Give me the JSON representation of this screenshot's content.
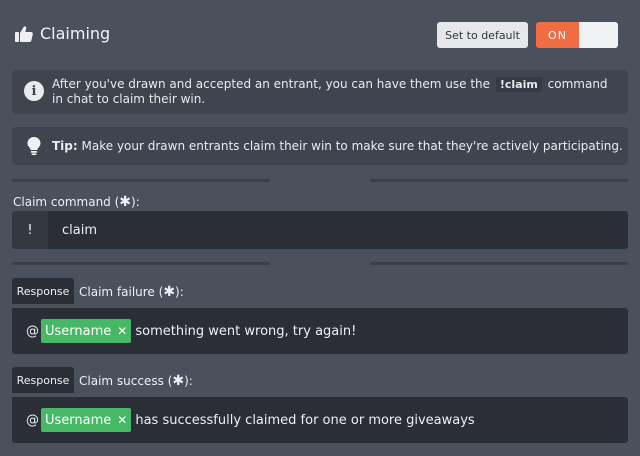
{
  "header": {
    "title": "Claiming",
    "title_icon": "thumbs-up-icon",
    "set_default_label": "Set to default",
    "toggle_label": "ON"
  },
  "info": {
    "icon": "info-icon",
    "text_before": "After you've drawn and accepted an entrant, you can have them use the",
    "command": "!claim",
    "text_after": "command in chat to claim their win."
  },
  "tip": {
    "icon": "lightbulb-icon",
    "prefix": "Tip:",
    "text": "Make your drawn entrants claim their win to make sure that they're actively participating."
  },
  "claim_command": {
    "label": "Claim command (",
    "required_mark": "✱",
    "label_end": "):",
    "prefix": "!",
    "value": "claim"
  },
  "claim_failure": {
    "tag": "Response",
    "label": "Claim failure (",
    "required_mark": "✱",
    "label_end": "):",
    "at": "@",
    "variable": "Username",
    "remove_mark": "✕",
    "message": "something went wrong, try again!"
  },
  "claim_success": {
    "tag": "Response",
    "label": "Claim success (",
    "required_mark": "✱",
    "label_end": "):",
    "at": "@",
    "variable": "Username",
    "remove_mark": "✕",
    "message": "has successfully claimed for one or more giveaways"
  },
  "colors": {
    "background": "#4b505d",
    "panel": "#40444f",
    "input": "#2b2e36",
    "toggle_on": "#ef6c45",
    "variable_chip": "#46b866"
  }
}
